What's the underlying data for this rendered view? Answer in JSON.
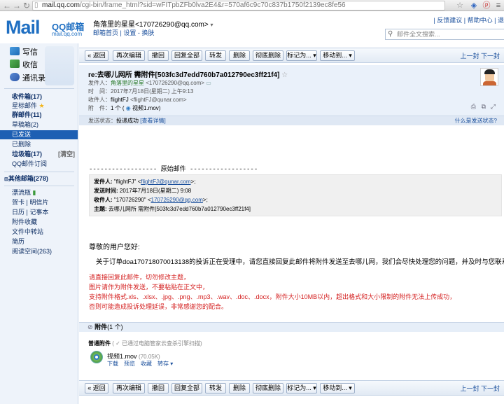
{
  "browser": {
    "url_host": "mail.qq.com",
    "url_path": "/cgi-bin/frame_html?sid=wFITpbZFb0lva2E4&r=570af6c9c70c837b1750f2139ec8fe56"
  },
  "header": {
    "logo_text": "Mail",
    "logo_brand": "QQ邮箱",
    "logo_domain": "mail.qq.com",
    "account": "角落里的星星<170726290@qq.com>",
    "account_links": "邮箱首页 | 设置 - 换肤",
    "top_links": "| 反馈建议 | 帮助中心 | 退",
    "search_placeholder": "邮件全文搜索..."
  },
  "sidebar": {
    "quick": [
      {
        "label": "写信"
      },
      {
        "label": "收信"
      },
      {
        "label": "通讯录"
      }
    ],
    "folders": [
      {
        "label": "收件箱(17)",
        "bold": true
      },
      {
        "label": "星标邮件 ★",
        "bold": false
      },
      {
        "label": "群邮件(11)",
        "bold": true
      },
      {
        "label": "草稿箱(2)",
        "bold": false
      },
      {
        "label": "已发送",
        "bold": false,
        "active": true
      },
      {
        "label": "已删除",
        "bold": false
      },
      {
        "label": "垃圾箱(17)",
        "bold": true,
        "right": "[清空]"
      },
      {
        "label": "QQ邮件订阅",
        "bold": false
      }
    ],
    "other_mail": "其他邮箱(278)",
    "apps": [
      {
        "label": "漂流瓶"
      },
      {
        "label": "贺卡 | 明信片"
      },
      {
        "label": "日历 | 记事本"
      },
      {
        "label": "附件收藏"
      },
      {
        "label": "文件中转站"
      },
      {
        "label": "简历"
      },
      {
        "label": "阅读空间(263)"
      }
    ]
  },
  "toolbar": {
    "buttons": [
      "« 返回",
      "再次编辑",
      "撤回",
      "回复全部",
      "转发",
      "删除",
      "彻底删除",
      "标记为... ▾",
      "移动到... ▾"
    ],
    "prev_next": "上一封 下一封"
  },
  "mail": {
    "subject": "re:去哪儿网所 需附件[503fc3d7edd760b7a012790ec3ff21f4]",
    "from_label": "发件人：",
    "from_value": "角落里的星星",
    "from_addr": "<170726290@qq.com>",
    "time_label": "时　间：",
    "time_value": "2017年7月18日(星期二) 上午9:13",
    "to_label": "收件人：",
    "to_value": "flightFJ",
    "to_addr": "<flightFJ@qunar.com>",
    "attach_label": "附　件：",
    "attach_value": "1 个 (",
    "attach_file": "视频1.mov)"
  },
  "status": {
    "label": "发送状态：",
    "value": "投递成功",
    "detail": "[查看详情]",
    "help": "什么是发送状态?"
  },
  "body": {
    "original_line": "------------------ 原始邮件 ------------------",
    "quote": [
      {
        "label": "发件人: ",
        "value": "\"flightFJ\" <",
        "link": "flightFJ@qunar.com",
        "tail": ">;"
      },
      {
        "label": "发送时间: ",
        "value": "2017年7月18日(星期二) 9:08",
        "link": "",
        "tail": ""
      },
      {
        "label": "收件人: ",
        "value": "\"170726290\" <",
        "link": "170726290@qq.com",
        "tail": ">;"
      },
      {
        "label": "主题: ",
        "value": "去哪儿网所 需附件[503fc3d7edd760b7a012790ec3ff21f4]",
        "link": "",
        "tail": ""
      }
    ],
    "greeting": "尊敬的用户您好:",
    "notice": "关于订单doa170718070013138的投诉正在受理中，请您直接回复此邮件将附件发送至去哪儿网，我们会尽快处理您的问题，并及时与您联系。",
    "red_lines": [
      "请直接回复此邮件，切勿修改主题，",
      "图片请作为附件发送，不要粘贴在正文中，",
      "支持附件格式.xls、.xlsx、.jpg、.png、.mp3、.wav、.doc、.docx，附件大小10MB以内，超出格式和大小限制的附件无法上传成功，",
      "否则可能造成投诉处理延误，非常感谢您的配合。"
    ]
  },
  "attachments": {
    "header": "附件",
    "count": "(1 个)",
    "normal_label": "普通附件",
    "scan_note": "( ✓ 已通过电脑管家云查杀引擎扫描)",
    "file_name": "视频1.mov",
    "file_size": "(70.05K)",
    "actions": "下载　预览　收藏　转存 ▾"
  }
}
